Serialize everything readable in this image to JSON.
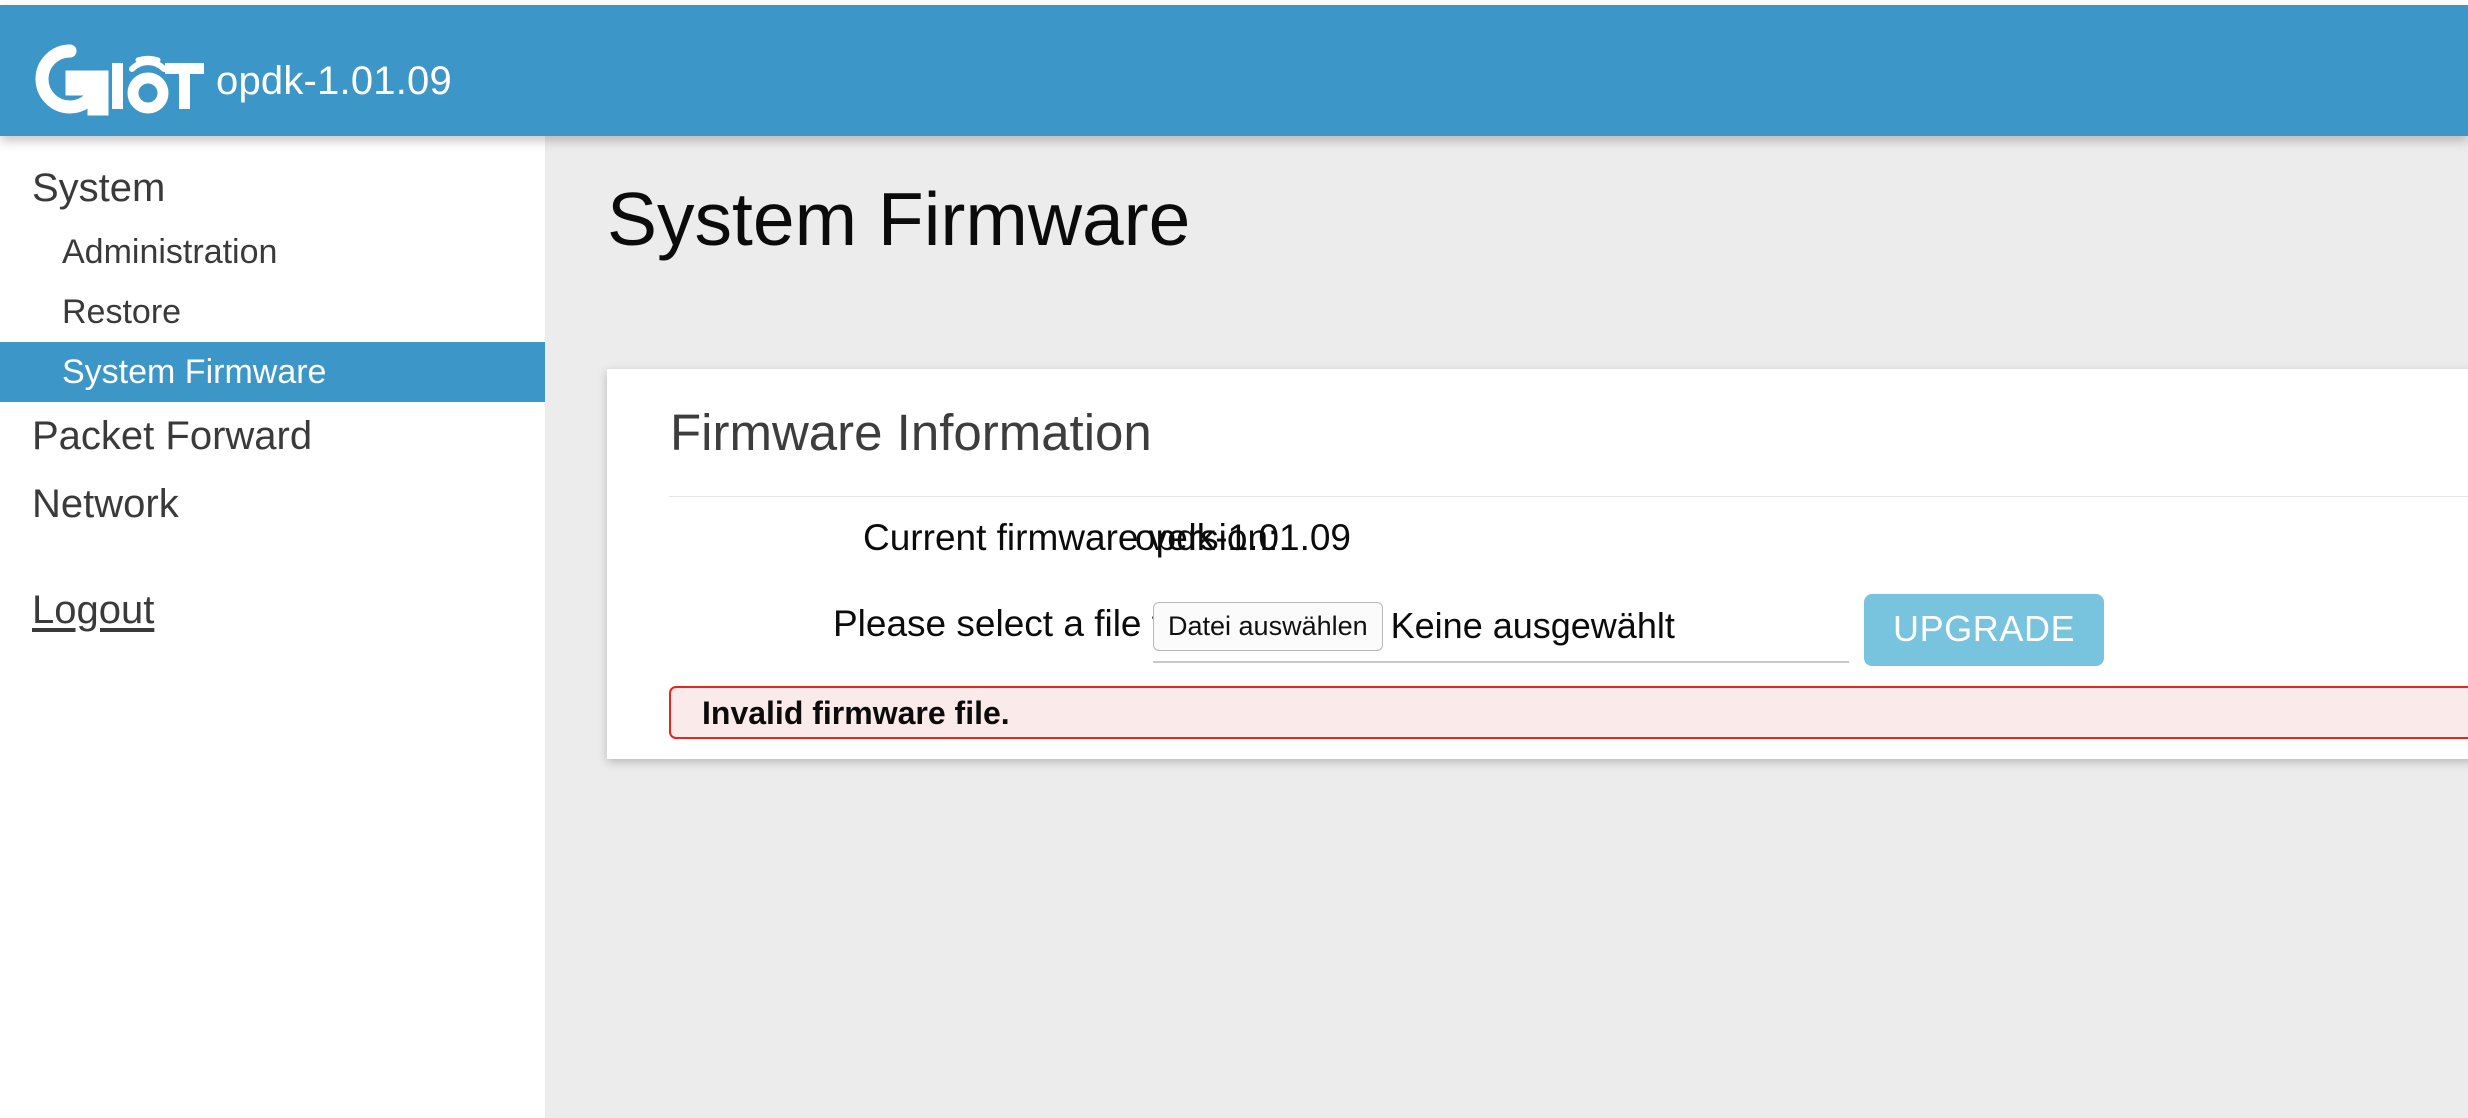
{
  "header": {
    "logo_text": "GIoT",
    "logo_icon": "wifi-signal-icon",
    "firmware_version": "opdk-1.01.09",
    "background_color": "#3c97c8"
  },
  "sidebar": {
    "items": [
      {
        "label": "System",
        "level": "top",
        "active": false
      },
      {
        "label": "Administration",
        "level": "sub",
        "active": false
      },
      {
        "label": "Restore",
        "level": "sub",
        "active": false
      },
      {
        "label": "System Firmware",
        "level": "sub",
        "active": true
      },
      {
        "label": "Packet Forward",
        "level": "top",
        "active": false
      },
      {
        "label": "Network",
        "level": "top",
        "active": false
      }
    ],
    "logout_label": "Logout",
    "active_background": "#3c97c8"
  },
  "main": {
    "page_title": "System Firmware",
    "background_color": "#ececec",
    "card": {
      "title": "Firmware Information",
      "version_label": "Current firmware version:",
      "version_value": "opdk-1.01.09",
      "upload_label": "Please select a file to upgrade:",
      "file_button_label": "Datei auswählen",
      "file_status_text": "Keine ausgewählt",
      "upgrade_button_label": "UPGRADE",
      "upgrade_button_color": "#78c3de"
    },
    "alert": {
      "message": "Invalid firmware file.",
      "border_color": "#e8251a",
      "background_color": "#fbeaea"
    }
  }
}
